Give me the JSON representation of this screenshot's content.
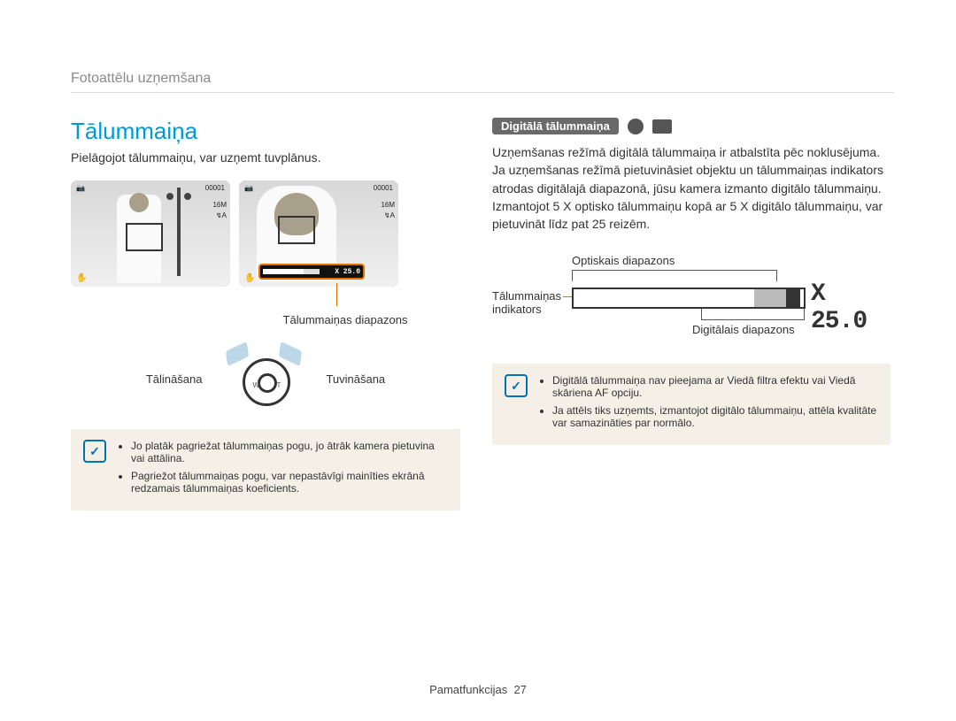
{
  "breadcrumb": "Fotoattēlu uzņemšana",
  "title": "Tālummaiņa",
  "intro": "Pielāgojot tālummaiņu, var uzņemt tuvplānus.",
  "thumb_hud": {
    "counter": "00001",
    "battery": "▮",
    "flash": "↯A",
    "size": "16M",
    "stab": "✋"
  },
  "zoom_bar_value": "X 25.0",
  "label_zoom_range": "Tālummaiņas diapazons",
  "label_zoom_out": "Tālināšana",
  "label_zoom_in": "Tuvināšana",
  "dial": {
    "w": "W",
    "t": "T"
  },
  "note1": {
    "icon": "✓",
    "items": [
      "Jo platāk pagriežat tālummaiņas pogu, jo ātrāk kamera pietuvina vai attālina.",
      "Pagriežot tālummaiņas pogu, var nepastāvīgi mainīties ekrānā redzamais tālummaiņas koeficients."
    ]
  },
  "right": {
    "pill": "Digitālā tālummaiņa",
    "para": "Uzņemšanas režīmā digitālā tālummaiņa ir atbalstīta pēc noklusējuma. Ja uzņemšanas režīmā pietuvināsiet objektu un tālummaiņas indikators atrodas digitālajā diapazonā, jūsu kamera izmanto digitālo tālummaiņu. Izmantojot 5 X optisko tālummaiņu kopā ar 5 X digitālo tālummaiņu, var pietuvināt līdz pat 25 reizēm."
  },
  "zoom_diagram": {
    "optical": "Optiskais diapazons",
    "digital": "Digitālais diapazons",
    "indicator": "Tālummaiņas indikators",
    "value": "X 25.0"
  },
  "note2": {
    "icon": "✓",
    "items": [
      "Digitālā tālummaiņa nav pieejama ar Viedā filtra efektu vai Viedā skāriena AF opciju.",
      "Ja attēls tiks uzņemts, izmantojot digitālo tālummaiņu, attēla kvalitāte var samazināties par normālo."
    ]
  },
  "footer": {
    "section": "Pamatfunkcijas",
    "page": "27"
  }
}
